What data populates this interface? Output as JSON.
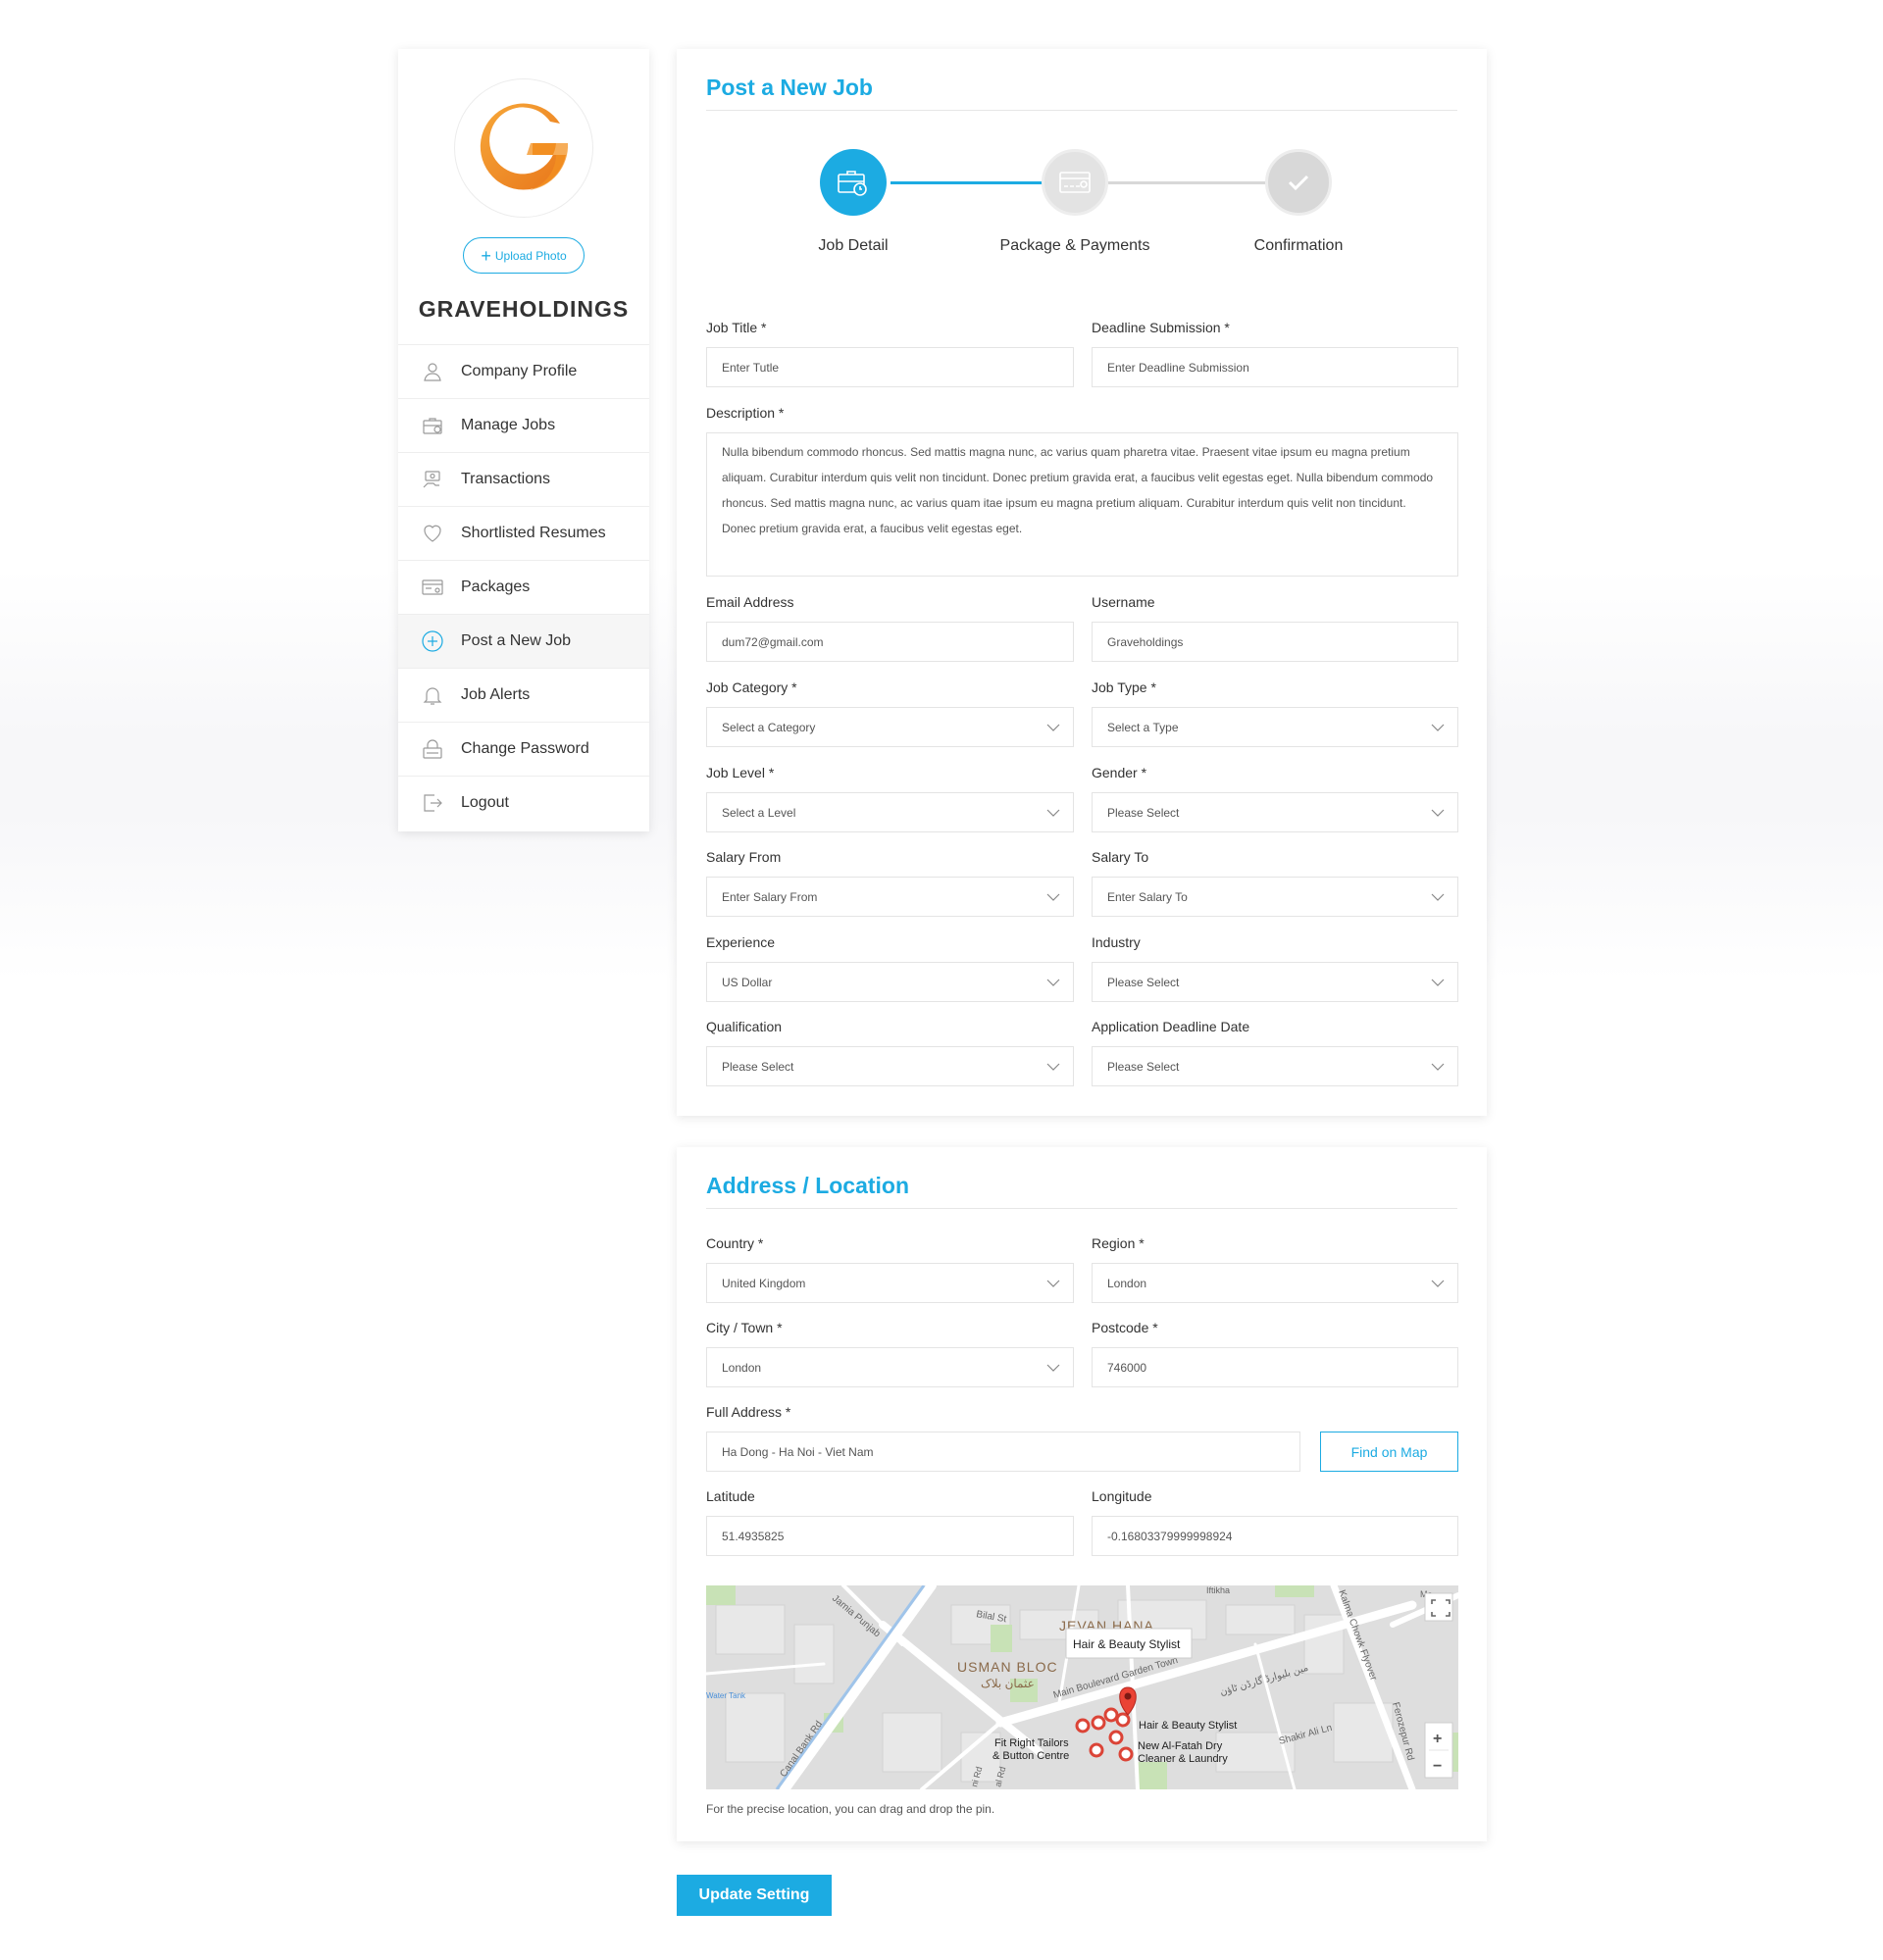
{
  "colors": {
    "accent": "#1cabe2",
    "logo_orange": "#f39222",
    "text": "#333333"
  },
  "sidebar": {
    "upload_label": "Upload Photo",
    "company_name": "GRAVEHOLDINGS",
    "items": [
      {
        "label": "Company Profile",
        "icon": "user-icon"
      },
      {
        "label": "Manage Jobs",
        "icon": "briefcase-icon"
      },
      {
        "label": "Transactions",
        "icon": "money-icon"
      },
      {
        "label": "Shortlisted Resumes",
        "icon": "heart-icon"
      },
      {
        "label": "Packages",
        "icon": "card-icon"
      },
      {
        "label": "Post a New Job",
        "icon": "plus-circle-icon",
        "active": true
      },
      {
        "label": "Job Alerts",
        "icon": "bell-icon"
      },
      {
        "label": "Change Password",
        "icon": "lock-icon"
      },
      {
        "label": "Logout",
        "icon": "logout-icon"
      }
    ]
  },
  "job": {
    "title": "Post a New Job",
    "steps": [
      {
        "label": "Job Detail",
        "state": "active"
      },
      {
        "label": "Package & Payments",
        "state": "inactive"
      },
      {
        "label": "Confirmation",
        "state": "inactive"
      }
    ],
    "fields": {
      "job_title": {
        "label": "Job Title *",
        "placeholder": "Enter Tutle"
      },
      "deadline": {
        "label": "Deadline Submission *",
        "placeholder": "Enter Deadline Submission"
      },
      "description": {
        "label": "Description *",
        "value": "Nulla bibendum commodo rhoncus. Sed mattis magna nunc, ac varius quam pharetra vitae. Praesent vitae ipsum eu magna pretium aliquam. Curabitur interdum quis velit non tincidunt. Donec pretium gravida erat, a faucibus velit egestas eget. Nulla bibendum commodo rhoncus. Sed mattis magna nunc, ac varius quam itae ipsum eu magna pretium aliquam. Curabitur interdum quis velit non tincidunt. Donec pretium gravida erat, a faucibus velit egestas eget."
      },
      "email": {
        "label": "Email Address",
        "value": "dum72@gmail.com"
      },
      "username": {
        "label": "Username",
        "value": "Graveholdings"
      },
      "category": {
        "label": "Job Category *",
        "value": "Select a Category"
      },
      "type": {
        "label": "Job Type *",
        "value": "Select a Type"
      },
      "level": {
        "label": "Job Level *",
        "value": "Select a Level"
      },
      "gender": {
        "label": "Gender *",
        "value": "Please Select"
      },
      "salary_from": {
        "label": "Salary From",
        "value": "Enter Salary From"
      },
      "salary_to": {
        "label": "Salary To",
        "value": "Enter Salary To"
      },
      "experience": {
        "label": "Experience",
        "value": "US Dollar"
      },
      "industry": {
        "label": "Industry",
        "value": "Please Select"
      },
      "qualification": {
        "label": "Qualification",
        "value": "Please Select"
      },
      "app_deadline": {
        "label": "Application Deadline Date",
        "value": "Please Select"
      }
    }
  },
  "address": {
    "title": "Address / Location",
    "country": {
      "label": "Country *",
      "value": "United Kingdom"
    },
    "region": {
      "label": "Region *",
      "value": "London"
    },
    "city": {
      "label": "City / Town *",
      "value": "London"
    },
    "postcode": {
      "label": "Postcode *",
      "value": "746000"
    },
    "full_address": {
      "label": "Full Address *",
      "value": "Ha Dong - Ha Noi - Viet Nam"
    },
    "find_on_map": "Find on Map",
    "latitude": {
      "label": "Latitude",
      "value": "51.4935825"
    },
    "longitude": {
      "label": "Longitude",
      "value": "-0.16803379999998924"
    },
    "map": {
      "labels": {
        "jamia_punjab": "Jamia Punjab",
        "bilal_st": "Bilal St",
        "jevan_hana": "JEVAN HANA",
        "usman_block": "USMAN BLOC",
        "usman_urdu": "عثمان بلاک",
        "main_blvd": "Main Boulevard Garden Town",
        "main_blvd_urdu": "مین بلیوارڈ گارڈن ٹاؤن",
        "kalma_chowk": "Kalma Chowk Flyover",
        "ferozepur": "Ferozepur Rd",
        "shakir_ali": "Shakir Ali Ln",
        "canal_bank": "Canal Bank Rd",
        "water_tank": "Water Tank",
        "iftikhar": "Iftikha",
        "ma": "Ma",
        "road_fragment_1": "ni Rd",
        "road_fragment_2": "al Rd",
        "popup": "Hair & Beauty Stylist",
        "poi_stylist": "Hair & Beauty Stylist",
        "poi_tailors": "Fit Right Tailors\n& Button Centre",
        "poi_laundry": "New Al-Fatah Dry\nCleaner & Laundry"
      },
      "zoom_in": "+",
      "zoom_out": "−"
    },
    "note": "For the precise location, you can drag and drop the pin."
  },
  "update_button": "Update Setting"
}
